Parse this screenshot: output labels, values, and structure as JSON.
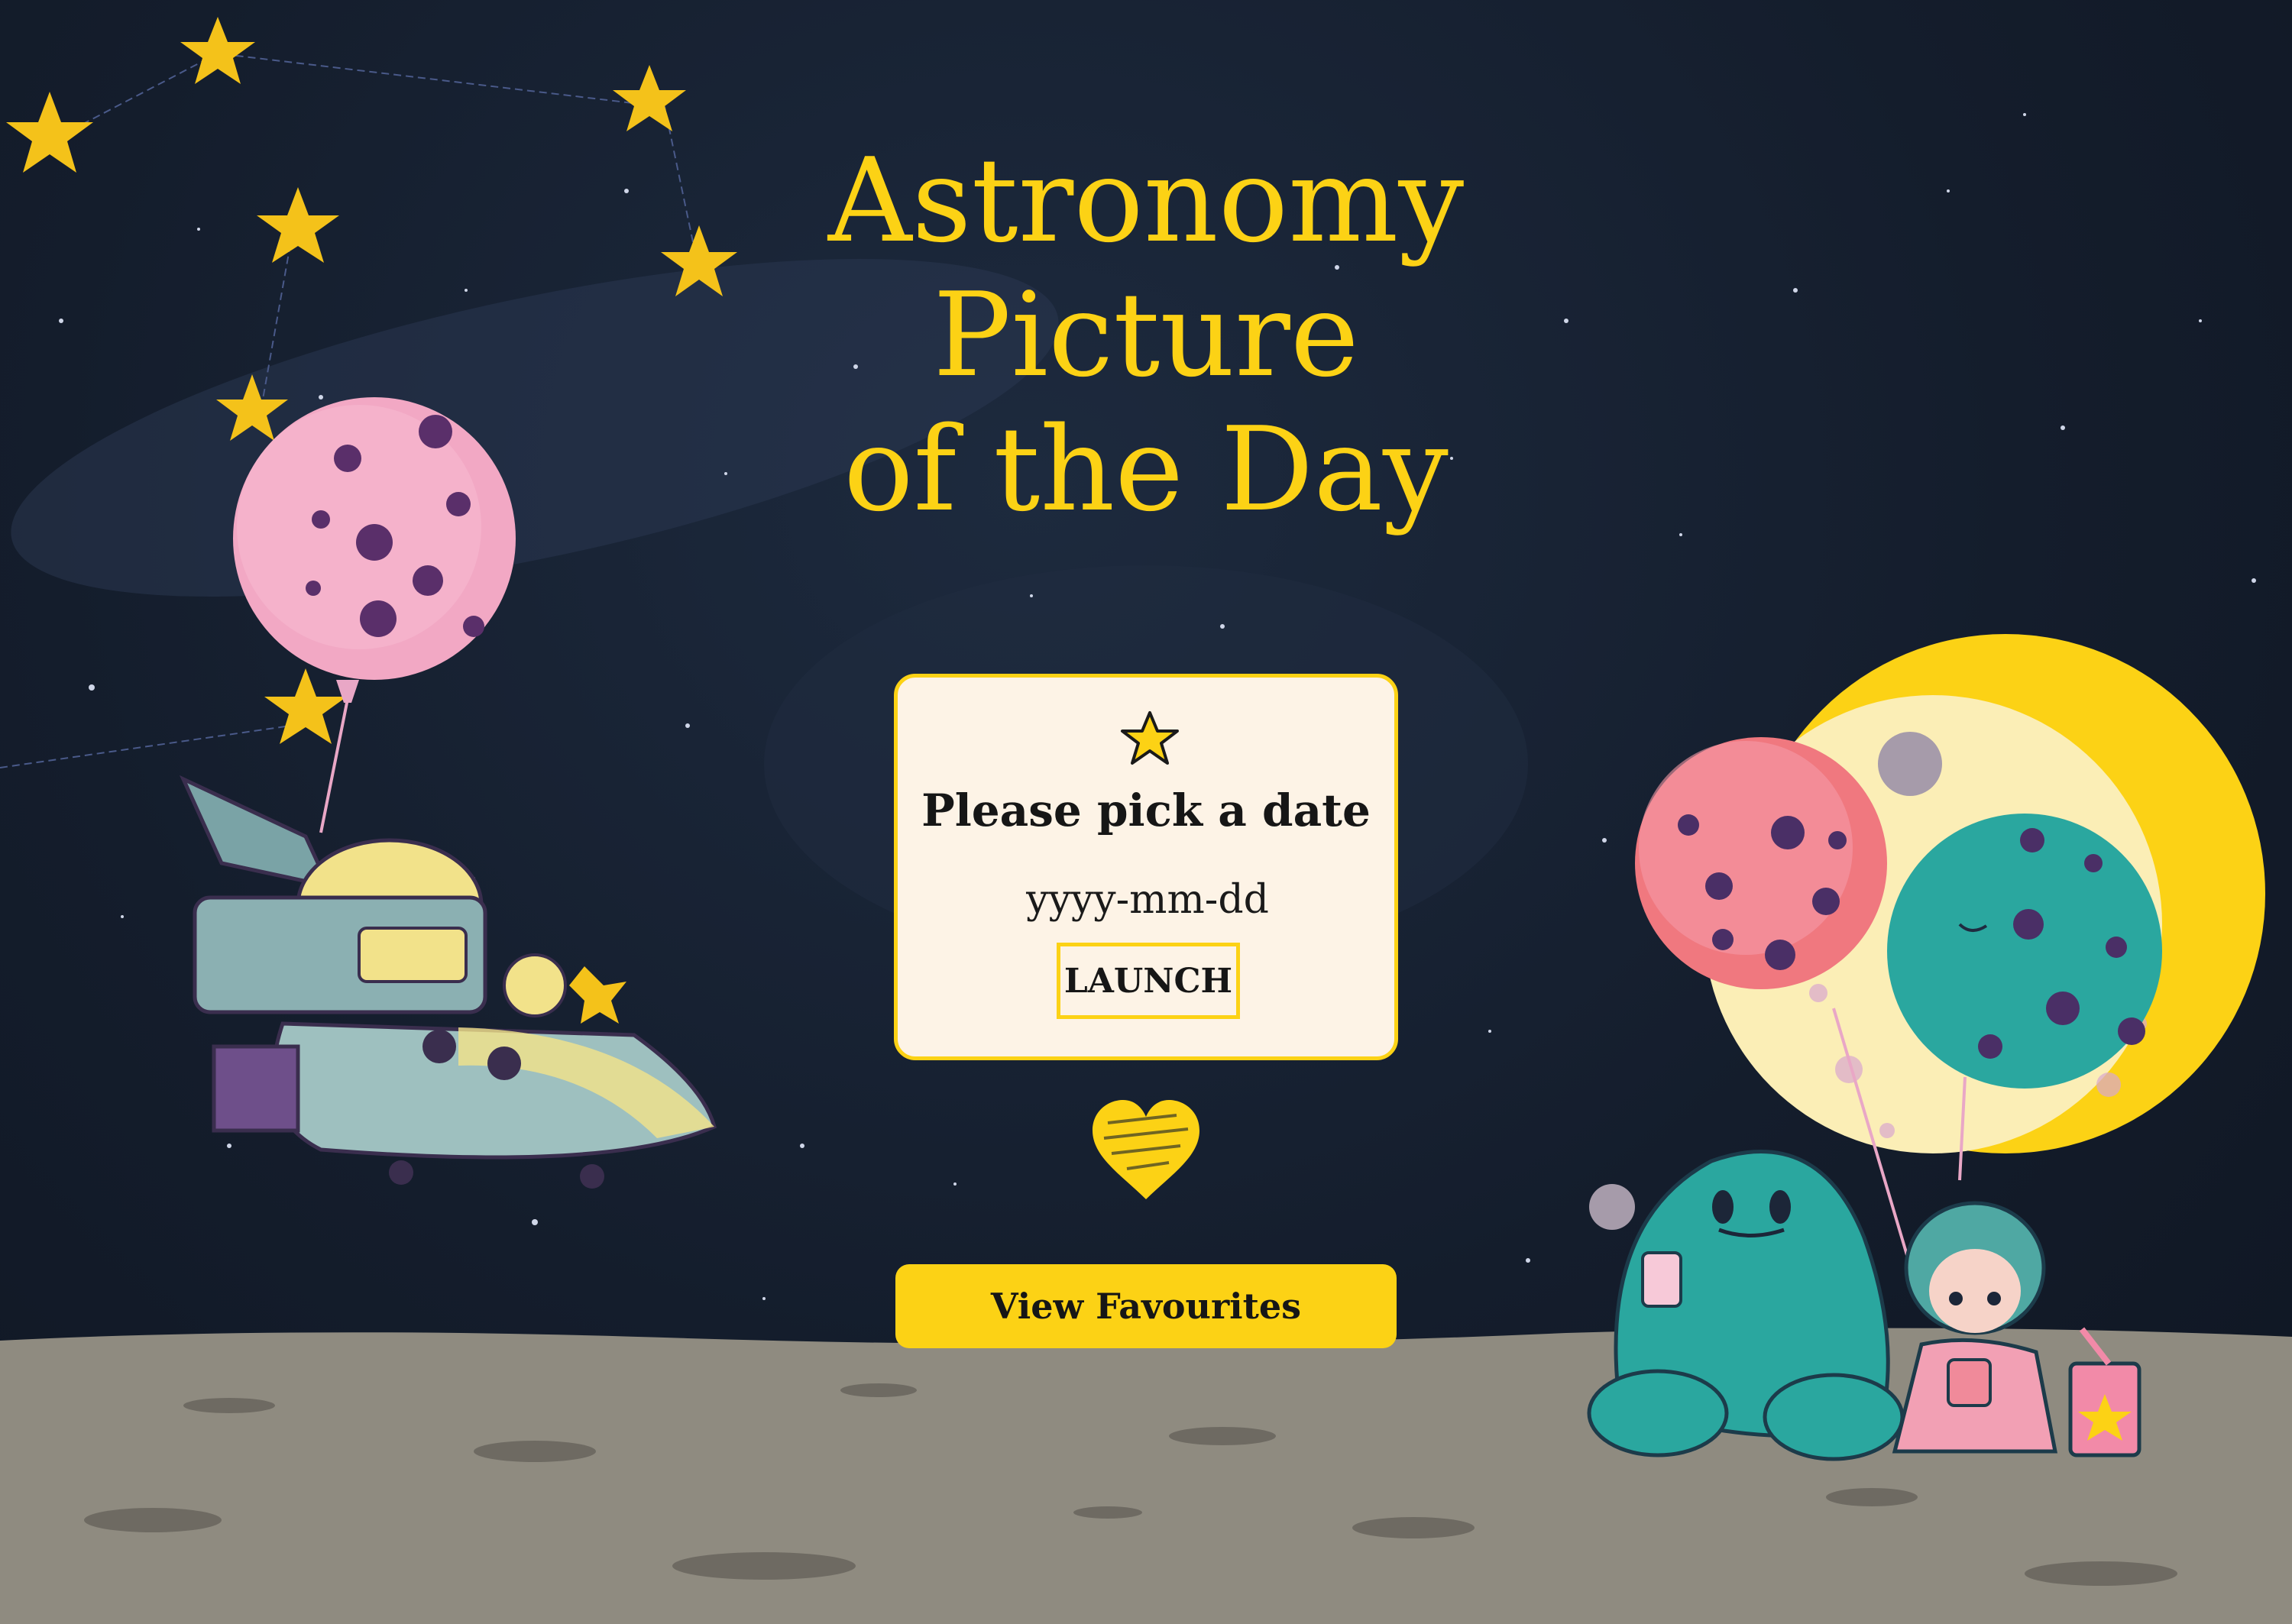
{
  "page": {
    "title_lines": [
      "Astronomy",
      "Picture",
      "of the Day"
    ]
  },
  "date_picker": {
    "prompt": "Please pick a date",
    "date_input_placeholder": "yyyy-mm-dd",
    "launch_label": "LAUNCH"
  },
  "favourites": {
    "button_label": "View Favourites"
  },
  "icons": {
    "card_icon": "star-icon",
    "divider_icon": "heart-icon"
  },
  "colors": {
    "accent_yellow": "#fcd215",
    "card_background": "#fdf3e6",
    "night_sky": "#141d2c",
    "moon_ground": "#8f8b80",
    "text_dark": "#161616"
  }
}
